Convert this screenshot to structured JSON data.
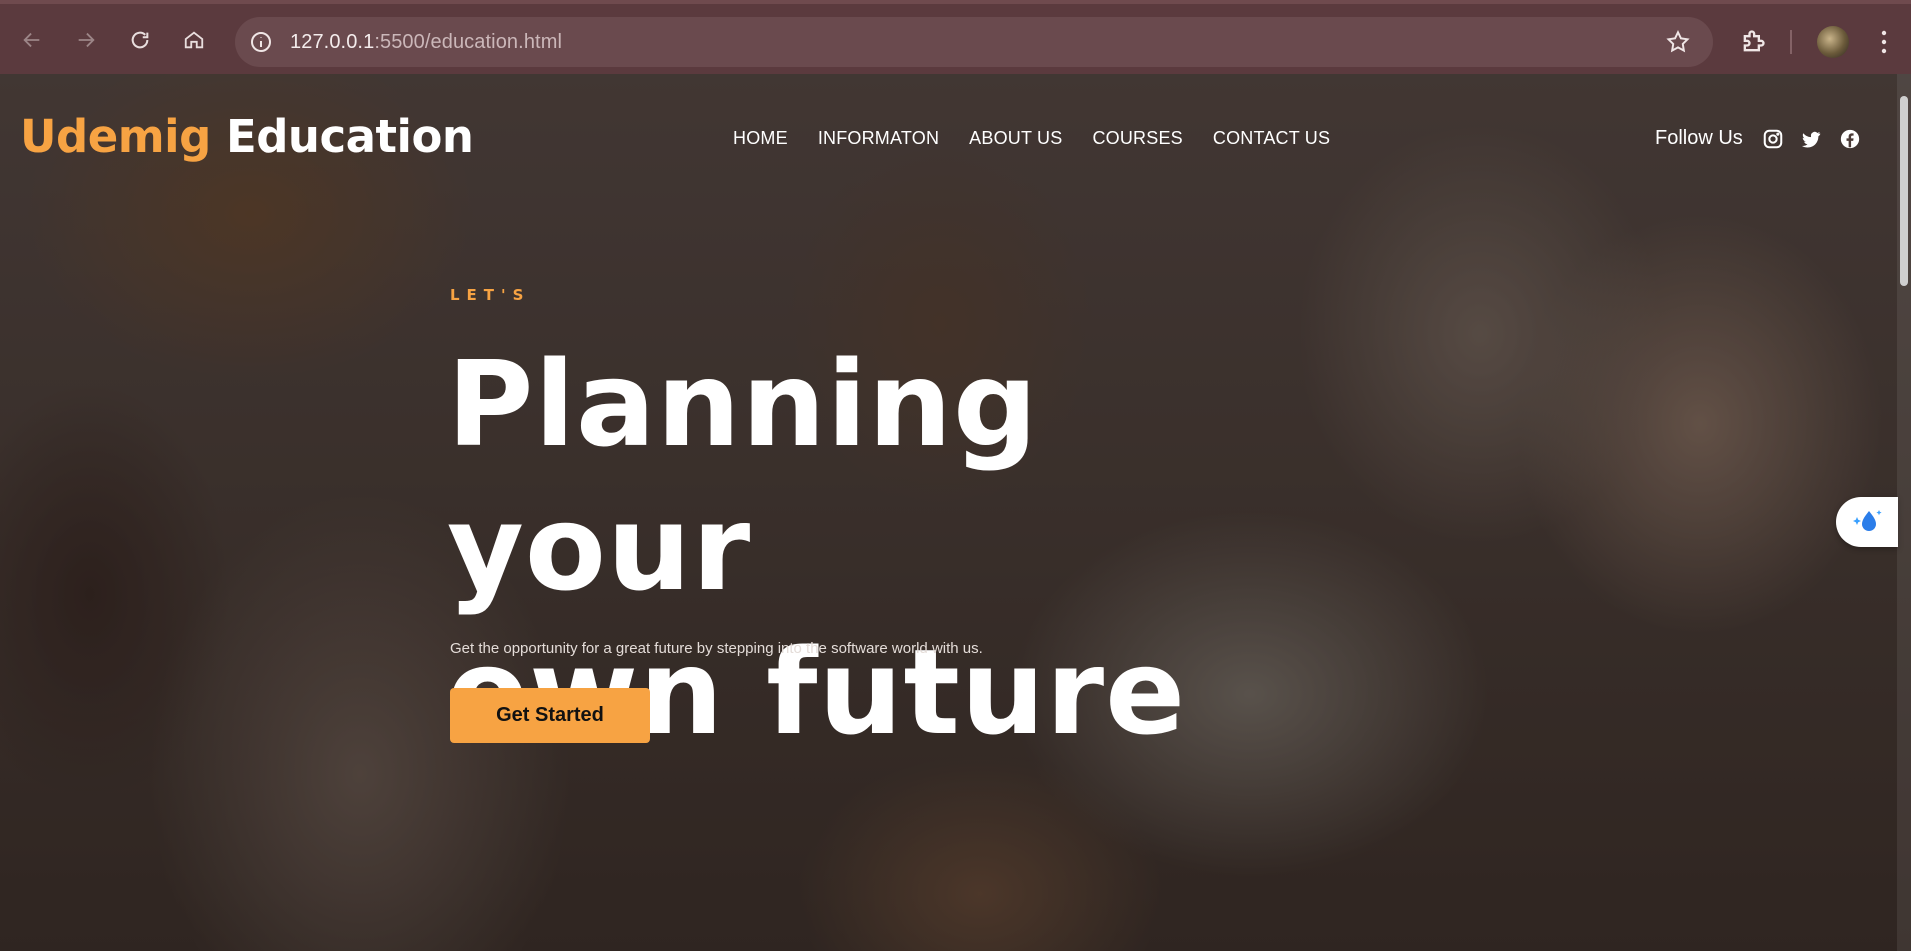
{
  "browser": {
    "url_host": "127.0.0.1",
    "url_path": ":5500/education.html",
    "icons": {
      "back": "arrow-left-icon",
      "forward": "arrow-right-icon",
      "reload": "reload-icon",
      "home": "home-icon",
      "site_info": "info-icon",
      "bookmark": "star-icon",
      "extensions": "puzzle-icon",
      "menu": "kebab-menu-icon"
    }
  },
  "header": {
    "logo_brand": "Udemig",
    "logo_rest": "Education",
    "nav": [
      {
        "label": "HOME"
      },
      {
        "label": "INFORMATON"
      },
      {
        "label": "ABOUT US"
      },
      {
        "label": "COURSES"
      },
      {
        "label": "CONTACT US"
      }
    ],
    "follow_label": "Follow Us",
    "social_icons": [
      "instagram-icon",
      "twitter-icon",
      "facebook-icon"
    ]
  },
  "hero": {
    "eyebrow": "LET'S",
    "headline_line1": "Planning your",
    "headline_line2": "own future",
    "subtitle": "Get the opportunity for a great future by stepping into the software world with us.",
    "cta_label": "Get Started"
  },
  "colors": {
    "accent": "#f7a343",
    "chrome": "#5b3a3e",
    "text": "#ffffff"
  }
}
